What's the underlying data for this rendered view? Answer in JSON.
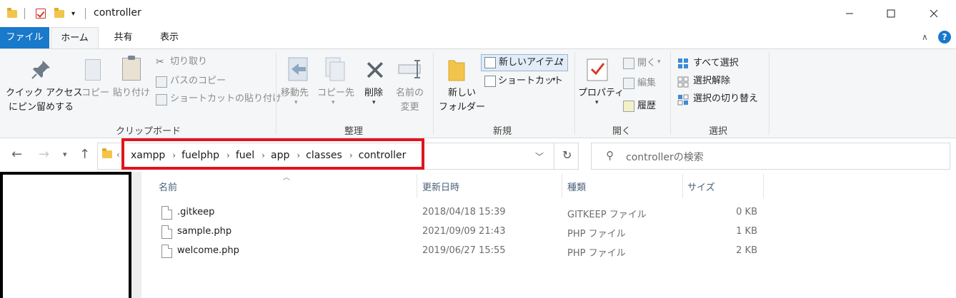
{
  "window": {
    "title": "controller"
  },
  "tabs": {
    "file": "ファイル",
    "home": "ホーム",
    "share": "共有",
    "view": "表示"
  },
  "ribbon": {
    "clipboard": {
      "label": "クリップボード",
      "pin_line1": "クイック アクセス",
      "pin_line2": "にピン留めする",
      "copy": "コピー",
      "paste": "貼り付け",
      "cut": "切り取り",
      "copy_path": "パスのコピー",
      "paste_shortcut": "ショートカットの貼り付け"
    },
    "organize": {
      "label": "整理",
      "move_to": "移動先",
      "copy_to": "コピー先",
      "delete": "削除",
      "rename_line1": "名前の",
      "rename_line2": "変更"
    },
    "new": {
      "label": "新規",
      "new_folder_line1": "新しい",
      "new_folder_line2": "フォルダー",
      "new_item": "新しいアイテム",
      "shortcut": "ショートカット"
    },
    "open": {
      "label": "開く",
      "properties": "プロパティ",
      "open": "開く",
      "edit": "編集",
      "history": "履歴"
    },
    "select": {
      "label": "選択",
      "select_all": "すべて選択",
      "select_none": "選択解除",
      "invert": "選択の切り替え"
    }
  },
  "address": {
    "crumbs": [
      "xampp",
      "fuelphp",
      "fuel",
      "app",
      "classes",
      "controller"
    ]
  },
  "search": {
    "placeholder": "controllerの検索"
  },
  "columns": {
    "name": "名前",
    "date": "更新日時",
    "type": "種類",
    "size": "サイズ"
  },
  "files": [
    {
      "name": ".gitkeep",
      "date": "2018/04/18 15:39",
      "type": "GITKEEP ファイル",
      "size": "0 KB"
    },
    {
      "name": "sample.php",
      "date": "2021/09/09 21:43",
      "type": "PHP ファイル",
      "size": "1 KB"
    },
    {
      "name": "welcome.php",
      "date": "2019/06/27 15:55",
      "type": "PHP ファイル",
      "size": "2 KB"
    }
  ],
  "colors": {
    "accent": "#1979ca",
    "highlight_box": "#e0141e",
    "folder": "#f3c44c"
  }
}
